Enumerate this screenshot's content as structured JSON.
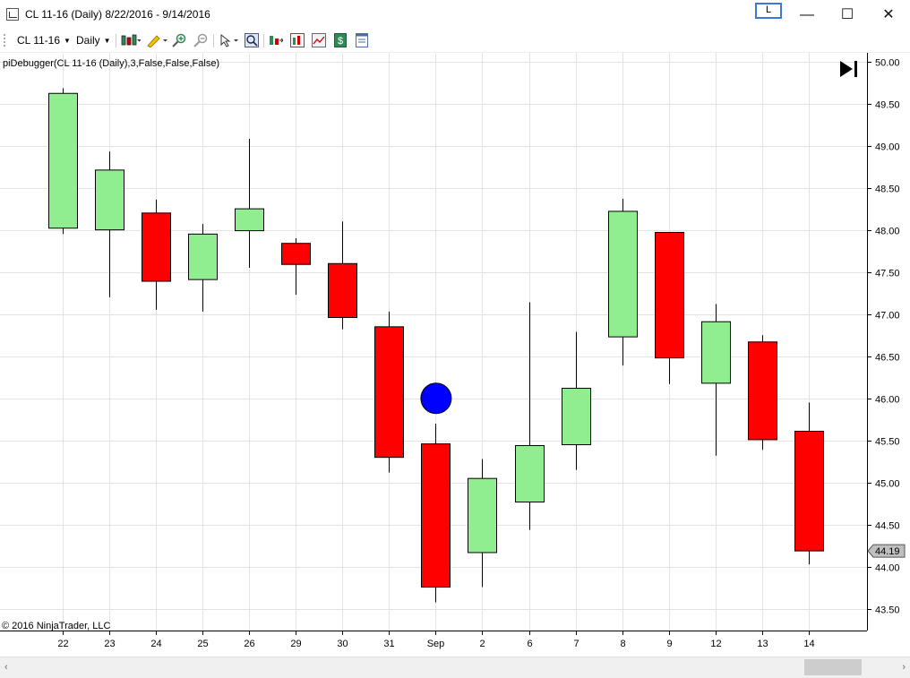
{
  "window": {
    "title": "CL 11-16 (Daily)  8/22/2016 - 9/14/2016",
    "link_button": "L",
    "minimize": "—",
    "maximize": "☐",
    "close": "✕"
  },
  "toolbar": {
    "instrument": "CL 11-16",
    "interval": "Daily",
    "icons": [
      "chart-style-icon",
      "drawing-tool-icon",
      "zoom-in-icon",
      "zoom-out-icon",
      "cursor-icon",
      "magnifier-icon",
      "bar-spacing-icon",
      "data-box-icon",
      "strategies-icon",
      "chart-trader-icon",
      "properties-icon"
    ]
  },
  "chart": {
    "indicator_label": "piDebugger(CL 11-16 (Daily),3,False,False,False)",
    "copyright": "© 2016 NinjaTrader, LLC",
    "last_price_label": "44.19",
    "go_to_end_icon": "go-to-end-icon",
    "colors": {
      "up": "#90ee90",
      "down": "#ff0000",
      "marker": "#0000ff",
      "grid": "#e3e3e3"
    }
  },
  "chart_data": {
    "type": "candlestick",
    "ylim": [
      43.5,
      50.0
    ],
    "ytick_labels": [
      "50.00",
      "49.50",
      "49.00",
      "48.50",
      "48.00",
      "47.50",
      "47.00",
      "46.50",
      "46.00",
      "45.50",
      "45.00",
      "44.50",
      "44.00",
      "43.50"
    ],
    "ytick_values": [
      50.0,
      49.5,
      49.0,
      48.5,
      48.0,
      47.5,
      47.0,
      46.5,
      46.0,
      45.5,
      45.0,
      44.5,
      44.0,
      43.5
    ],
    "categories": [
      "22",
      "23",
      "24",
      "25",
      "26",
      "29",
      "30",
      "31",
      "Sep",
      "2",
      "6",
      "7",
      "8",
      "9",
      "12",
      "13",
      "14"
    ],
    "candles": [
      {
        "o": 48.02,
        "h": 49.68,
        "l": 47.95,
        "c": 49.62
      },
      {
        "o": 48.0,
        "h": 48.93,
        "l": 47.2,
        "c": 48.71
      },
      {
        "o": 48.2,
        "h": 48.36,
        "l": 47.05,
        "c": 47.39
      },
      {
        "o": 47.41,
        "h": 48.07,
        "l": 47.03,
        "c": 47.95
      },
      {
        "o": 47.99,
        "h": 49.08,
        "l": 47.55,
        "c": 48.25
      },
      {
        "o": 47.84,
        "h": 47.9,
        "l": 47.23,
        "c": 47.59
      },
      {
        "o": 47.6,
        "h": 48.1,
        "l": 46.82,
        "c": 46.96
      },
      {
        "o": 46.85,
        "h": 47.03,
        "l": 45.12,
        "c": 45.3
      },
      {
        "o": 45.46,
        "h": 45.7,
        "l": 43.58,
        "c": 43.76
      },
      {
        "o": 44.17,
        "h": 45.28,
        "l": 43.76,
        "c": 45.05
      },
      {
        "o": 44.77,
        "h": 47.14,
        "l": 44.44,
        "c": 45.44
      },
      {
        "o": 45.45,
        "h": 46.79,
        "l": 45.15,
        "c": 46.12
      },
      {
        "o": 46.73,
        "h": 48.37,
        "l": 46.39,
        "c": 48.22
      },
      {
        "o": 47.97,
        "h": 47.97,
        "l": 46.17,
        "c": 46.48
      },
      {
        "o": 46.18,
        "h": 47.12,
        "l": 45.32,
        "c": 46.91
      },
      {
        "o": 46.67,
        "h": 46.75,
        "l": 45.39,
        "c": 45.51
      },
      {
        "o": 45.61,
        "h": 45.95,
        "l": 44.03,
        "c": 44.19
      }
    ],
    "markers": [
      {
        "index": 8,
        "y": 46.0,
        "shape": "circle"
      }
    ],
    "last_price": 44.19,
    "grid": true
  }
}
